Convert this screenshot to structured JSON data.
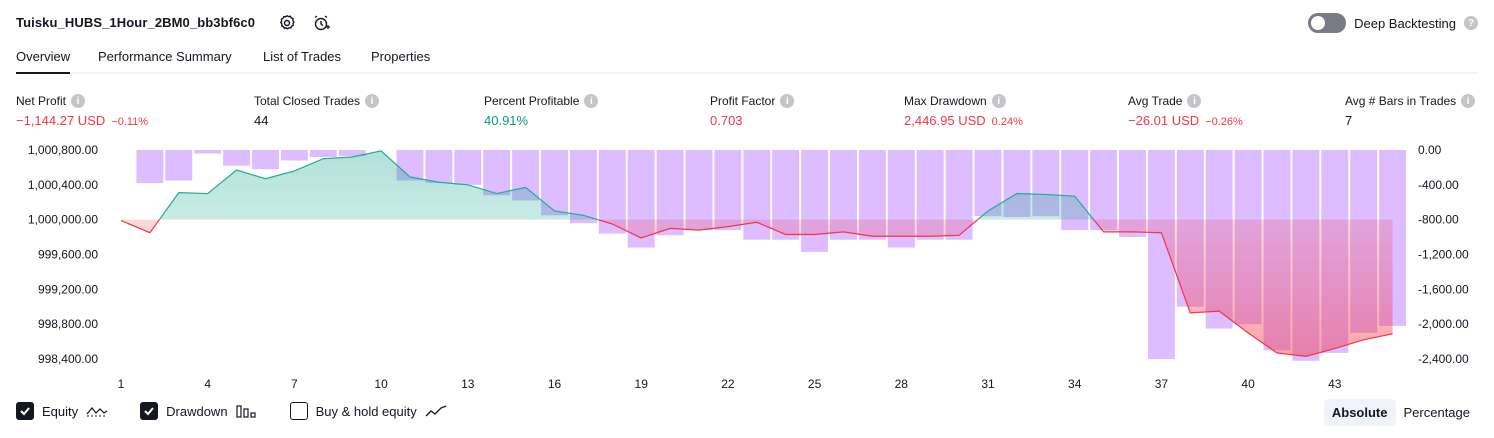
{
  "header": {
    "strategy_name": "Tuisku_HUBS_1Hour_2BM0_bb3bf6c0",
    "settings_icon": "gear-icon",
    "alert_icon": "alarm-clock-plus-icon",
    "deep_backtesting_label": "Deep Backtesting",
    "deep_backtesting_enabled": false
  },
  "tabs": [
    {
      "label": "Overview",
      "active": true
    },
    {
      "label": "Performance Summary",
      "active": false
    },
    {
      "label": "List of Trades",
      "active": false
    },
    {
      "label": "Properties",
      "active": false
    }
  ],
  "metrics": [
    {
      "label": "Net Profit",
      "value": "−1,144.27 USD",
      "sub": "−0.11%",
      "color": "red"
    },
    {
      "label": "Total Closed Trades",
      "value": "44",
      "sub": "",
      "color": "dark"
    },
    {
      "label": "Percent Profitable",
      "value": "40.91%",
      "sub": "",
      "color": "green"
    },
    {
      "label": "Profit Factor",
      "value": "0.703",
      "sub": "",
      "color": "red"
    },
    {
      "label": "Max Drawdown",
      "value": "2,446.95 USD",
      "sub": "0.24%",
      "color": "red"
    },
    {
      "label": "Avg Trade",
      "value": "−26.01 USD",
      "sub": "−0.26%",
      "color": "red"
    },
    {
      "label": "Avg # Bars in Trades",
      "value": "7",
      "sub": "",
      "color": "dark"
    }
  ],
  "chart_data": {
    "type": "line",
    "x": [
      1,
      2,
      3,
      4,
      5,
      6,
      7,
      8,
      9,
      10,
      11,
      12,
      13,
      14,
      15,
      16,
      17,
      18,
      19,
      20,
      21,
      22,
      23,
      24,
      25,
      26,
      27,
      28,
      29,
      30,
      31,
      32,
      33,
      34,
      35,
      36,
      37,
      38,
      39,
      40,
      41,
      42,
      43,
      44,
      45
    ],
    "x_tick_labels": [
      "1",
      "4",
      "7",
      "10",
      "13",
      "16",
      "19",
      "22",
      "25",
      "28",
      "31",
      "34",
      "37",
      "40",
      "43"
    ],
    "y_left_ticks": [
      "1,000,800.00",
      "1,000,400.00",
      "1,000,000.00",
      "999,600.00",
      "999,200.00",
      "998,800.00",
      "998,400.00"
    ],
    "y_right_ticks": [
      "0.00",
      "-400.00",
      "-800.00",
      "-1,200.00",
      "-1,600.00",
      "-2,000.00",
      "-2,400.00"
    ],
    "ylim_left": [
      998,
      400,
      1000,
      800
    ],
    "ylim_right": [
      -2400,
      0
    ],
    "baseline_equity": 1000000,
    "series": [
      {
        "name": "Equity",
        "type": "line",
        "values": [
          999990,
          999850,
          1000310,
          1000300,
          1000570,
          1000470,
          1000560,
          1000700,
          1000720,
          1000790,
          1000490,
          1000430,
          1000400,
          1000300,
          1000370,
          1000100,
          1000050,
          999950,
          999790,
          999900,
          999880,
          999920,
          999970,
          999830,
          999830,
          999860,
          999810,
          999810,
          999810,
          999820,
          1000100,
          1000300,
          1000290,
          1000270,
          999860,
          999860,
          999850,
          998930,
          998950,
          998700,
          998470,
          998430,
          998520,
          998620,
          998690
        ]
      },
      {
        "name": "Drawdown",
        "type": "bar",
        "values": [
          0,
          -380,
          -350,
          -40,
          -180,
          -220,
          -120,
          -80,
          -70,
          0,
          -350,
          -380,
          -400,
          -520,
          -580,
          -750,
          -840,
          -960,
          -1120,
          -980,
          -920,
          -920,
          -1030,
          -1030,
          -1170,
          -1030,
          -1030,
          -1120,
          -1030,
          -1030,
          -760,
          -770,
          -760,
          -920,
          -920,
          -1000,
          -2400,
          -1800,
          -2050,
          -2000,
          -2300,
          -2420,
          -2330,
          -2100,
          -2020
        ]
      }
    ]
  },
  "legend": [
    {
      "label": "Equity",
      "checked": true,
      "icon": "equity-line-icon"
    },
    {
      "label": "Drawdown",
      "checked": true,
      "icon": "drawdown-bars-icon"
    },
    {
      "label": "Buy & hold equity",
      "checked": false,
      "icon": "buy-hold-line-icon"
    }
  ],
  "view_mode": {
    "options": [
      "Absolute",
      "Percentage"
    ],
    "selected": "Absolute"
  },
  "colors": {
    "equity_up": "#22ab94",
    "equity_down": "#f23645",
    "drawdown_bar": "#d1a6ff",
    "text": "#131722",
    "muted": "#787b86"
  }
}
